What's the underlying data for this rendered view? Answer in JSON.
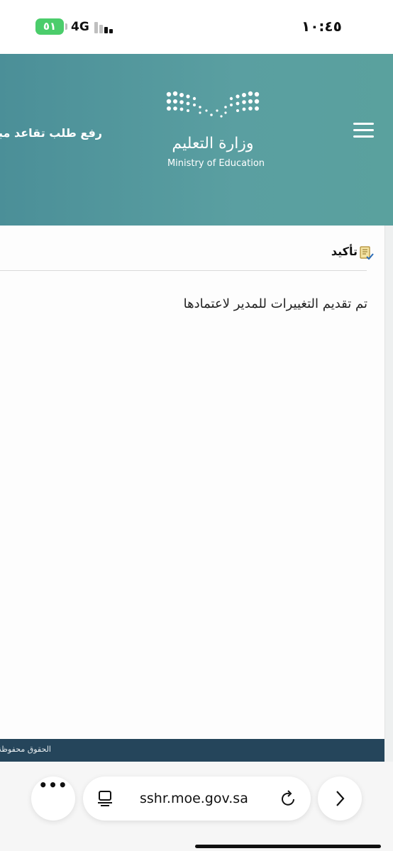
{
  "status_bar": {
    "time": "١٠:٤٥",
    "battery": "٥١",
    "network": "4G"
  },
  "header": {
    "title": "رفع طلب تقاعد مبكر",
    "logo_arabic": "وزارة التعليم",
    "logo_english": "Ministry of Education",
    "background_color": "#5a9fa1",
    "menu_icon": "hamburger-icon"
  },
  "content": {
    "section_title": "تأكيد",
    "section_icon": "document-check-icon",
    "message": "تم تقديم التغييرات للمدير لاعتمادها"
  },
  "footer": {
    "text": "الحقوق محفوظة",
    "background_color": "#25455b"
  },
  "browser": {
    "url": "sshr.moe.gov.sa",
    "more_icon": "more-icon",
    "page_icon": "page-settings-icon",
    "reload_icon": "reload-icon",
    "forward_icon": "chevron-right-icon"
  }
}
